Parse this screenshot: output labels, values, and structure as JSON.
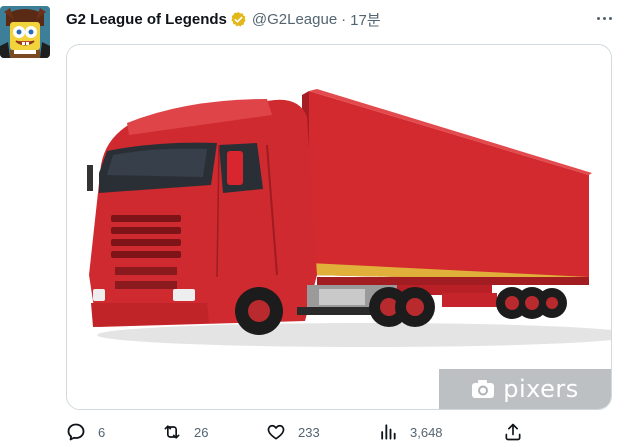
{
  "tweet": {
    "display_name": "G2 League of Legends",
    "handle": "@G2League",
    "separator": "·",
    "timestamp": "17분",
    "verified_color": "#e2b719",
    "avatar_icon": "spongebob-avatar-icon",
    "more_icon": "more-horizontal-icon"
  },
  "media": {
    "subject": "red-semi-truck-photo",
    "watermark_text": "pixers",
    "truck_color": "#d9262e"
  },
  "actions": {
    "reply": {
      "icon": "reply-icon",
      "count": "6"
    },
    "retweet": {
      "icon": "retweet-icon",
      "count": "26"
    },
    "like": {
      "icon": "heart-icon",
      "count": "233"
    },
    "views": {
      "icon": "views-icon",
      "count": "3,648"
    },
    "share": {
      "icon": "share-icon"
    }
  },
  "colors": {
    "text_primary": "#0f1419",
    "text_secondary": "#536471",
    "border": "#cfd9de"
  }
}
